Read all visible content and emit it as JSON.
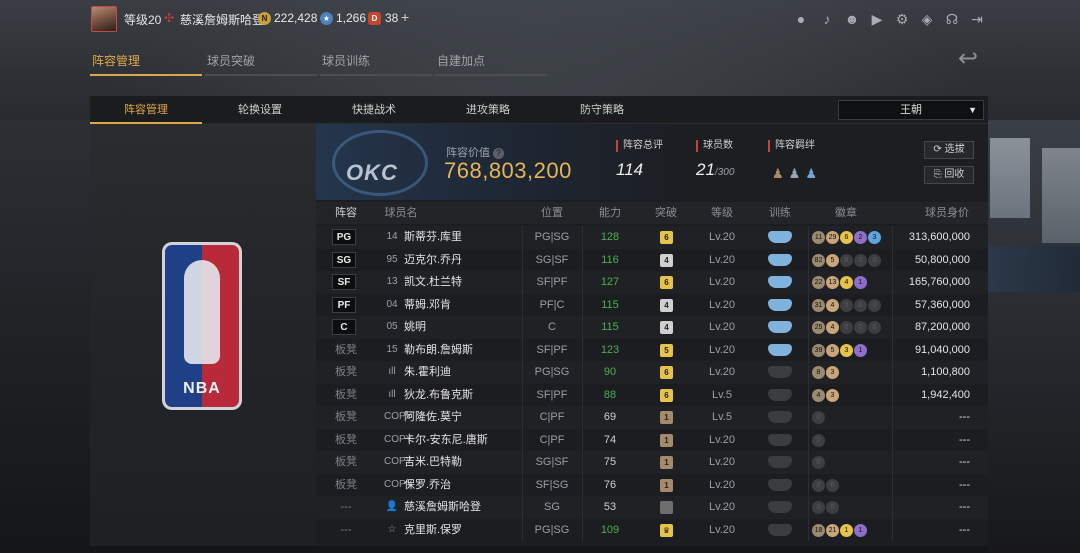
{
  "topbar": {
    "level": "等级20",
    "player_name": "慈溪詹姆斯哈登",
    "gold": "222,428",
    "stars": "1,266",
    "tickets": "38",
    "plus": "+"
  },
  "main_tabs": [
    "阵容管理",
    "球员突破",
    "球员训练",
    "自建加点"
  ],
  "sub_tabs": [
    "阵容管理",
    "轮换设置",
    "快捷战术",
    "进攻策略",
    "防守策略"
  ],
  "dropdown": {
    "value": "王朝"
  },
  "lineup": {
    "value_label": "阵容价值",
    "value": "768,803,200",
    "team_logo_text": "OKC",
    "rating_label": "阵容总评",
    "rating": "114",
    "players_label": "球员数",
    "players": "21",
    "players_max": "/300",
    "bond_label": "阵容羁绊",
    "btn_select": "选拔",
    "btn_recycle": "回收"
  },
  "nba_logo_text": "NBA",
  "table": {
    "headers": [
      "阵容",
      "球员名",
      "位置",
      "能力",
      "突破",
      "等级",
      "训练",
      "徽章",
      "球员身价"
    ],
    "rows": [
      {
        "slot": "PG",
        "slot_type": "starter",
        "num": "14",
        "name": "斯蒂芬.库里",
        "pos": "PG|SG",
        "ability": "128",
        "ability_color": "#4caf50",
        "breach": "6",
        "breach_color": "#e6c34a",
        "level": "Lv.20",
        "train": "blue",
        "badges": [
          "11",
          "29",
          "6",
          "2",
          "3"
        ],
        "price": "313,600,000"
      },
      {
        "slot": "SG",
        "slot_type": "starter",
        "num": "95",
        "name": "迈克尔.乔丹",
        "pos": "SG|SF",
        "ability": "116",
        "ability_color": "#4caf50",
        "breach": "4",
        "breach_color": "#d0d0d0",
        "level": "Lv.20",
        "train": "blue",
        "badges": [
          "82",
          "5",
          "0",
          "0",
          "0"
        ],
        "price": "50,800,000"
      },
      {
        "slot": "SF",
        "slot_type": "starter",
        "num": "13",
        "name": "凯文.杜兰特",
        "pos": "SF|PF",
        "ability": "127",
        "ability_color": "#4caf50",
        "breach": "6",
        "breach_color": "#e6c34a",
        "level": "Lv.20",
        "train": "blue",
        "badges": [
          "22",
          "13",
          "4",
          "1"
        ],
        "price": "165,760,000"
      },
      {
        "slot": "PF",
        "slot_type": "starter",
        "num": "04",
        "name": "蒂姆.邓肯",
        "pos": "PF|C",
        "ability": "115",
        "ability_color": "#4caf50",
        "breach": "4",
        "breach_color": "#d0d0d0",
        "level": "Lv.20",
        "train": "blue",
        "badges": [
          "31",
          "4",
          "0",
          "0",
          "0"
        ],
        "price": "57,360,000"
      },
      {
        "slot": "C",
        "slot_type": "starter",
        "num": "05",
        "name": "姚明",
        "pos": "C",
        "ability": "115",
        "ability_color": "#4caf50",
        "breach": "4",
        "breach_color": "#d0d0d0",
        "level": "Lv.20",
        "train": "blue",
        "badges": [
          "25",
          "4",
          "0",
          "0",
          "0"
        ],
        "price": "87,200,000"
      },
      {
        "slot": "板凳",
        "slot_type": "bench",
        "num": "15",
        "name": "勒布朗.詹姆斯",
        "pos": "SF|PF",
        "ability": "123",
        "ability_color": "#4caf50",
        "breach": "5",
        "breach_color": "#e6c34a",
        "level": "Lv.20",
        "train": "blue",
        "badges": [
          "39",
          "5",
          "3",
          "1"
        ],
        "price": "91,040,000"
      },
      {
        "slot": "板凳",
        "slot_type": "bench",
        "num": "ıll",
        "name": "朱.霍利迪",
        "pos": "PG|SG",
        "ability": "90",
        "ability_color": "#4caf50",
        "breach": "6",
        "breach_color": "#e6c34a",
        "level": "Lv.20",
        "train": "grey",
        "badges": [
          "8",
          "3"
        ],
        "price": "1,100,800"
      },
      {
        "slot": "板凳",
        "slot_type": "bench",
        "num": "ıll",
        "name": "狄龙.布鲁克斯",
        "pos": "SF|PF",
        "ability": "88",
        "ability_color": "#4caf50",
        "breach": "6",
        "breach_color": "#e6c34a",
        "level": "Lv.5",
        "train": "grey",
        "badges": [
          "4",
          "3"
        ],
        "price": "1,942,400"
      },
      {
        "slot": "板凳",
        "slot_type": "bench",
        "num": "COPY",
        "name": "阿隆佐.莫宁",
        "pos": "C|PF",
        "ability": "69",
        "ability_color": "#d0d0d0",
        "breach": "1",
        "breach_color": "#a58a6c",
        "level": "Lv.5",
        "train": "grey",
        "badges": [
          "0"
        ],
        "price": "---"
      },
      {
        "slot": "板凳",
        "slot_type": "bench",
        "num": "COPY",
        "name": "卡尔-安东尼.唐斯",
        "pos": "C|PF",
        "ability": "74",
        "ability_color": "#d0d0d0",
        "breach": "1",
        "breach_color": "#a58a6c",
        "level": "Lv.20",
        "train": "grey",
        "badges": [
          "0"
        ],
        "price": "---"
      },
      {
        "slot": "板凳",
        "slot_type": "bench",
        "num": "COPY",
        "name": "吉米.巴特勒",
        "pos": "SG|SF",
        "ability": "75",
        "ability_color": "#d0d0d0",
        "breach": "1",
        "breach_color": "#a58a6c",
        "level": "Lv.20",
        "train": "grey",
        "badges": [
          "0"
        ],
        "price": "---"
      },
      {
        "slot": "板凳",
        "slot_type": "bench",
        "num": "COPY",
        "name": "保罗.乔治",
        "pos": "SF|SG",
        "ability": "76",
        "ability_color": "#d0d0d0",
        "breach": "1",
        "breach_color": "#a58a6c",
        "level": "Lv.20",
        "train": "grey",
        "badges": [
          "0",
          "0"
        ],
        "price": "---"
      },
      {
        "slot": "---",
        "slot_type": "none",
        "num": "👤",
        "name": "慈溪詹姆斯哈登",
        "pos": "SG",
        "ability": "53",
        "ability_color": "#d0d0d0",
        "breach": "",
        "breach_color": "#6e6e6e",
        "level": "Lv.20",
        "train": "grey",
        "badges": [
          "0",
          "0"
        ],
        "price": "---"
      },
      {
        "slot": "---",
        "slot_type": "none",
        "num": "☆",
        "name": "克里斯.保罗",
        "pos": "PG|SG",
        "ability": "109",
        "ability_color": "#4caf50",
        "breach": "♛",
        "breach_color": "#e6c34a",
        "level": "Lv.20",
        "train": "grey",
        "badges": [
          "18",
          "21",
          "1",
          "1"
        ],
        "price": "---"
      }
    ]
  }
}
